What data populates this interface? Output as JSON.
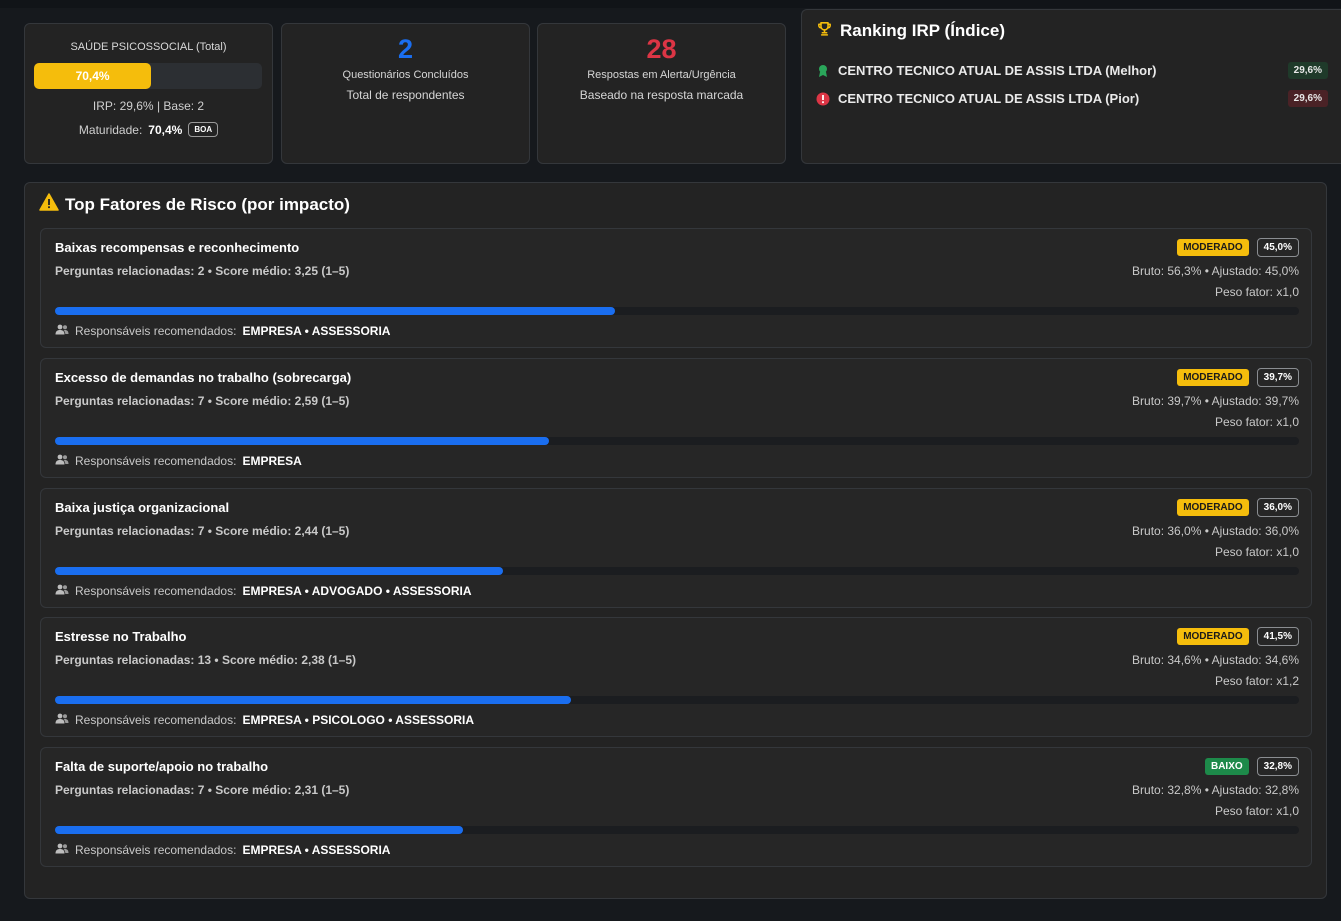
{
  "health": {
    "title": "SAÚDE PSICOSSOCIAL (Total)",
    "value_label": "70,4%",
    "value": 70.4,
    "irp_text": "IRP: 29,6% | Base: 2",
    "maturity_label": "Maturidade:",
    "maturity_value": "70,4%",
    "maturity_badge": "BOA",
    "bar_color": "#f5bd0c"
  },
  "completed": {
    "number": "2",
    "label": "Questionários Concluídos",
    "sub": "Total de respondentes",
    "color": "#1a6ef0"
  },
  "alerts": {
    "number": "28",
    "label": "Respostas em Alerta/Urgência",
    "sub": "Baseado na resposta marcada",
    "color": "#dc3545"
  },
  "ranking": {
    "title": "Ranking IRP (Índice)",
    "icon": "trophy-icon",
    "items": [
      {
        "name": "CENTRO TECNICO ATUAL DE ASSIS LTDA (Melhor)",
        "value": "29,6%",
        "icon": "award-icon"
      },
      {
        "name": "CENTRO TECNICO ATUAL DE ASSIS LTDA (Pior)",
        "value": "29,6%",
        "icon": "alert-circle-icon"
      }
    ]
  },
  "risk": {
    "title": "Top Fatores de Risco (por impacto)",
    "icon": "warning-icon",
    "meta_label": "Perguntas relacionadas:",
    "resp_label": "Responsáveis recomendados:",
    "factors": [
      {
        "name": "Baixas recompensas e reconhecimento",
        "questions": "2",
        "score": "Score médio: 3,25 (1–5)",
        "level": "MODERADO",
        "pct": "45,0%",
        "bruto": "Bruto: 56,3% • Ajustado: 45,0%",
        "peso": "Peso fator: x1,0",
        "progress": 45.0,
        "resp": "EMPRESA • ASSESSORIA"
      },
      {
        "name": "Excesso de demandas no trabalho (sobrecarga)",
        "questions": "7",
        "score": "Score médio: 2,59 (1–5)",
        "level": "MODERADO",
        "pct": "39,7%",
        "bruto": "Bruto: 39,7% • Ajustado: 39,7%",
        "peso": "Peso fator: x1,0",
        "progress": 39.7,
        "resp": "EMPRESA"
      },
      {
        "name": "Baixa justiça organizacional",
        "questions": "7",
        "score": "Score médio: 2,44 (1–5)",
        "level": "MODERADO",
        "pct": "36,0%",
        "bruto": "Bruto: 36,0% • Ajustado: 36,0%",
        "peso": "Peso fator: x1,0",
        "progress": 36.0,
        "resp": "EMPRESA • ADVOGADO • ASSESSORIA"
      },
      {
        "name": "Estresse no Trabalho",
        "questions": "13",
        "score": "Score médio: 2,38 (1–5)",
        "level": "MODERADO",
        "pct": "41,5%",
        "bruto": "Bruto: 34,6% • Ajustado: 34,6%",
        "peso": "Peso fator: x1,2",
        "progress": 41.5,
        "resp": "EMPRESA • PSICOLOGO • ASSESSORIA"
      },
      {
        "name": "Falta de suporte/apoio no trabalho",
        "questions": "7",
        "score": "Score médio: 2,31 (1–5)",
        "level": "BAIXO",
        "pct": "32,8%",
        "bruto": "Bruto: 32,8% • Ajustado: 32,8%",
        "peso": "Peso fator: x1,0",
        "progress": 32.8,
        "resp": "EMPRESA • ASSESSORIA"
      }
    ]
  }
}
